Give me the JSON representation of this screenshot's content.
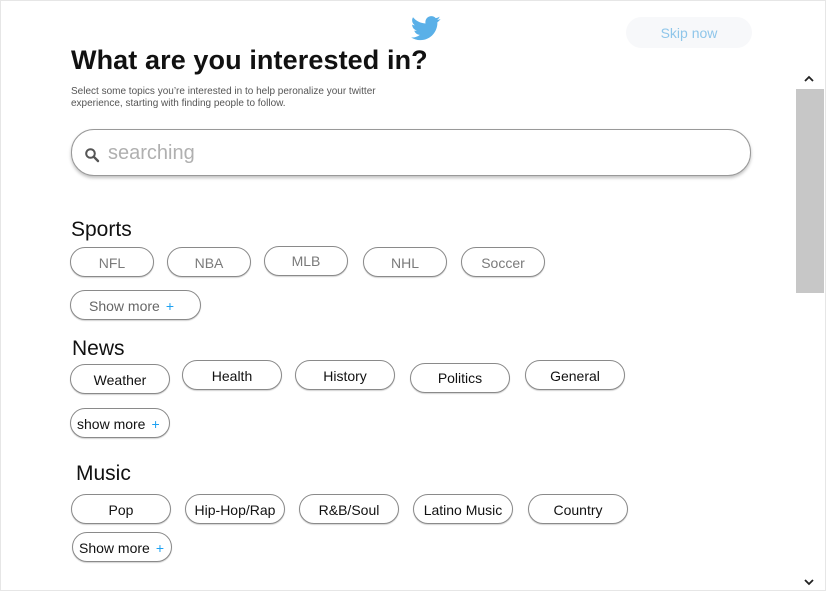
{
  "header": {
    "logo_icon": "twitter-bird-icon",
    "skip_label": "Skip now",
    "title": "What are you interested in?",
    "subtitle": "Select some topics you’re interested in to help peronalize your twitter experience, starting with finding people to follow."
  },
  "search": {
    "icon": "search-icon",
    "placeholder": "searching"
  },
  "sections": {
    "sports": {
      "title": "Sports",
      "chips": [
        "NFL",
        "NBA",
        "MLB",
        "NHL",
        "Soccer"
      ],
      "more_label": "Show more"
    },
    "news": {
      "title": "News",
      "chips": [
        "Weather",
        "Health",
        "History",
        "Politics",
        "General"
      ],
      "more_label": "show more"
    },
    "music": {
      "title": "Music",
      "chips": [
        "Pop",
        "Hip-Hop/Rap",
        "R&B/Soul",
        "Latino Music",
        "Country"
      ],
      "more_label": "Show more"
    }
  },
  "plus_symbol": "+",
  "colors": {
    "brand": "#1da1f2",
    "logo": "#5ab0e8",
    "skip_text": "#8fc6ea",
    "skip_bg": "#f7f8fa",
    "scroll_thumb": "#c7c7c7"
  }
}
